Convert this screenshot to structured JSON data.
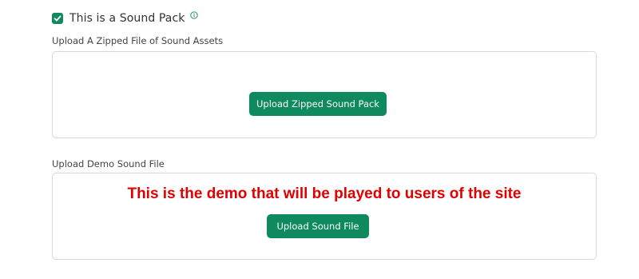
{
  "sound_pack_checkbox": {
    "label": "This is a Sound Pack",
    "checked": true,
    "icon": "checkmark-icon",
    "info_icon": "info-icon",
    "accent_color": "#0f8a5f"
  },
  "zipped_upload": {
    "label": "Upload A Zipped File of Sound Assets",
    "button_label": "Upload Zipped Sound Pack"
  },
  "demo_upload": {
    "label": "Upload Demo Sound File",
    "note": "This is the demo that will be played to users of the site",
    "note_color": "#e00000",
    "button_label": "Upload Sound File"
  }
}
